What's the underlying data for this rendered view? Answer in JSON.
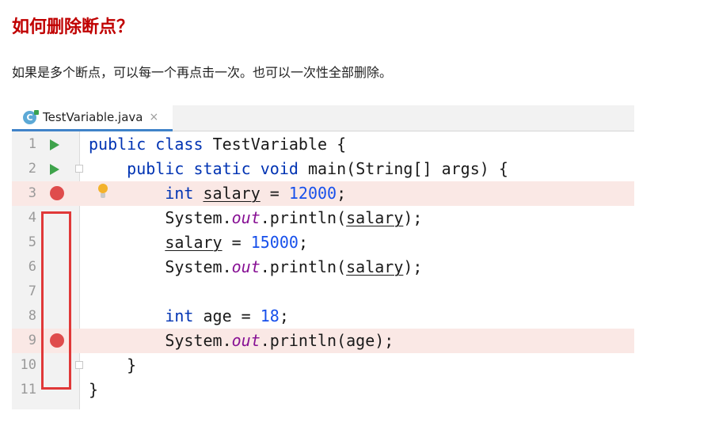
{
  "heading": "如何删除断点？",
  "description": "如果是多个断点，可以每一个再点击一次。也可以一次性全部删除。",
  "colors": {
    "heading": "#c00000",
    "keyword": "#0033b3",
    "number": "#1750eb",
    "static_field": "#871094",
    "breakpoint": "#df4c4c",
    "breakpoint_line": "#fae8e5",
    "run_gutter": "#3ea34b",
    "annotation_box": "#e03838"
  },
  "editor": {
    "tab": {
      "icon": "java-class-icon",
      "icon_letter": "C",
      "label": "TestVariable.java",
      "close": "×"
    },
    "lines": [
      {
        "num": "1",
        "gutter_icon": "run-icon"
      },
      {
        "num": "2",
        "gutter_icon": "run-icon"
      },
      {
        "num": "3",
        "gutter_icon": "breakpoint-icon",
        "breakpoint": true
      },
      {
        "num": "4"
      },
      {
        "num": "5"
      },
      {
        "num": "6"
      },
      {
        "num": "7"
      },
      {
        "num": "8"
      },
      {
        "num": "9",
        "gutter_icon": "breakpoint-icon",
        "breakpoint": true
      },
      {
        "num": "10"
      },
      {
        "num": "11"
      }
    ],
    "code": {
      "l1": {
        "kw1": "public",
        "kw2": "class",
        "name": "TestVariable",
        "brace": "{"
      },
      "l2": {
        "kw1": "public",
        "kw2": "static",
        "kw3": "void",
        "name": "main",
        "params": "(String[] args)",
        "brace": "{"
      },
      "l3": {
        "type": "int",
        "var": "salary",
        "eq": "=",
        "value": "12000",
        "end": ";"
      },
      "l4": {
        "cls": "System",
        "dot1": ".",
        "field": "out",
        "call": ".println(",
        "arg": "salary",
        "end": ");"
      },
      "l5": {
        "var": "salary",
        "eq": "=",
        "value": "15000",
        "end": ";"
      },
      "l6": {
        "cls": "System",
        "dot1": ".",
        "field": "out",
        "call": ".println(",
        "arg": "salary",
        "end": ");"
      },
      "l8": {
        "type": "int",
        "var": "age",
        "eq": "=",
        "value": "18",
        "end": ";"
      },
      "l9": {
        "cls": "System",
        "dot1": ".",
        "field": "out",
        "call": ".println(",
        "arg": "age",
        "end": ");"
      },
      "l10": {
        "brace": "}"
      },
      "l11": {
        "brace": "}"
      }
    },
    "intention_icon": "lightbulb-icon"
  }
}
